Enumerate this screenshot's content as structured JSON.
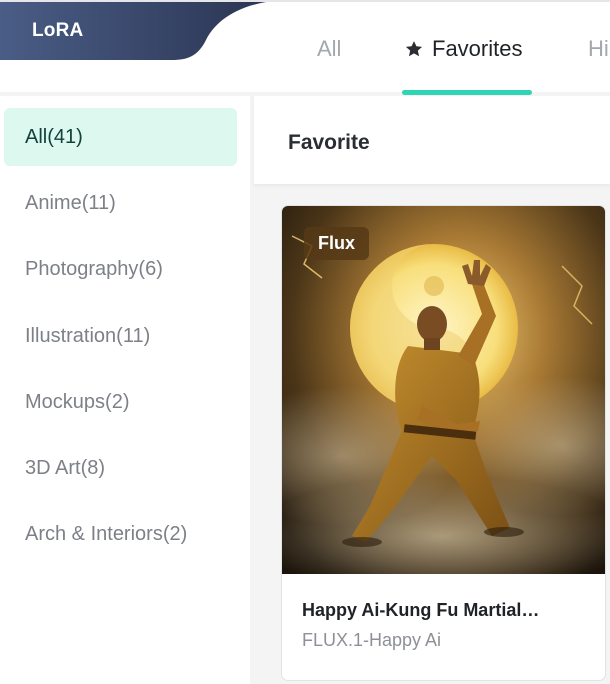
{
  "header": {
    "lora_label": "LoRA",
    "tabs": [
      {
        "label": "All"
      },
      {
        "label": "Favorites",
        "icon": "star-icon"
      },
      {
        "label": "Hi"
      }
    ],
    "active_tab": "Favorites",
    "accent": "#2fd4b4"
  },
  "sidebar": {
    "items": [
      {
        "label": "All(41)",
        "active": true
      },
      {
        "label": "Anime(11)"
      },
      {
        "label": "Photography(6)"
      },
      {
        "label": "Illustration(11)"
      },
      {
        "label": "Mockups(2)"
      },
      {
        "label": "3D Art(8)"
      },
      {
        "label": "Arch & Interiors(2)"
      }
    ]
  },
  "main": {
    "title": "Favorite",
    "cards": [
      {
        "badge": "Flux",
        "title": "Happy Ai-Kung Fu Martial…",
        "subtitle": "FLUX.1-Happy Ai",
        "image": "kung-fu-martial-artist-image"
      }
    ]
  }
}
